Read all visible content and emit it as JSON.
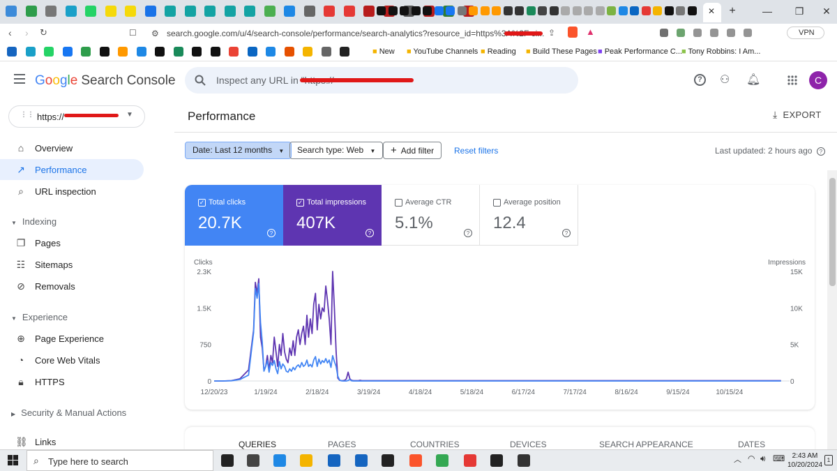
{
  "browser": {
    "url": "search.google.com/u/4/search-console/performance/search-analytics?resource_id=https%3A%2F",
    "url_tail": "ci...",
    "vpn_label": "VPN",
    "bookmarks": [
      "New",
      "YouTube Channels",
      "Reading",
      "Build These Pages",
      "Peak Performance C...",
      "Tony Robbins: I Am..."
    ]
  },
  "app": {
    "logo_google": [
      "G",
      "o",
      "o",
      "g",
      "l",
      "e"
    ],
    "logo_product": "Search Console",
    "search_placeholder": "Inspect any URL in \"https://",
    "avatar_letter": "C"
  },
  "sidebar": {
    "property": "https://",
    "items": {
      "overview": "Overview",
      "performance": "Performance",
      "url_inspection": "URL inspection",
      "indexing_header": "Indexing",
      "pages": "Pages",
      "sitemaps": "Sitemaps",
      "removals": "Removals",
      "experience_header": "Experience",
      "page_experience": "Page Experience",
      "core_web_vitals": "Core Web Vitals",
      "https": "HTTPS",
      "security_header": "Security & Manual Actions",
      "links": "Links"
    }
  },
  "main": {
    "title": "Performance",
    "export": "EXPORT",
    "filters": {
      "date": "Date: Last 12 months",
      "search_type": "Search type: Web",
      "add_filter": "Add filter",
      "reset": "Reset filters"
    },
    "last_updated": "Last updated: 2 hours ago",
    "metrics": {
      "clicks_label": "Total clicks",
      "clicks_value": "20.7K",
      "impressions_label": "Total impressions",
      "impressions_value": "407K",
      "ctr_label": "Average CTR",
      "ctr_value": "5.1%",
      "position_label": "Average position",
      "position_value": "12.4"
    },
    "tabs": [
      "QUERIES",
      "PAGES",
      "COUNTRIES",
      "DEVICES",
      "SEARCH APPEARANCE",
      "DATES"
    ]
  },
  "chart_data": {
    "type": "line",
    "ylabel_left": "Clicks",
    "ylabel_right": "Impressions",
    "left_ticks": [
      "0",
      "750",
      "1.5K",
      "2.3K"
    ],
    "right_ticks": [
      "0",
      "5K",
      "10K",
      "15K"
    ],
    "ylim_left": [
      0,
      2250
    ],
    "ylim_right": [
      0,
      15000
    ],
    "x_ticks": [
      "12/20/23",
      "1/19/24",
      "2/18/24",
      "3/19/24",
      "4/18/24",
      "5/18/24",
      "6/17/24",
      "7/17/24",
      "8/16/24",
      "9/15/24",
      "10/15/24"
    ],
    "series": [
      {
        "name": "Clicks",
        "color": "#4285f4",
        "x": [
          0,
          5,
          10,
          15,
          20,
          23,
          24,
          25,
          26,
          27,
          28,
          29,
          30,
          31,
          32,
          33,
          34,
          35,
          36,
          37,
          38,
          39,
          40,
          41,
          42,
          43,
          44,
          45,
          46,
          47,
          48,
          49,
          50,
          51,
          52,
          53,
          54,
          55,
          56,
          57,
          58,
          59,
          60,
          61,
          62,
          63,
          64,
          65,
          66,
          67,
          68,
          69,
          70,
          71,
          72,
          73,
          74,
          75,
          76,
          77,
          78,
          79,
          80,
          81,
          82,
          83,
          84,
          85,
          86,
          87,
          88,
          89,
          90,
          100,
          110,
          120,
          150,
          180,
          210,
          240,
          270,
          300,
          330
        ],
        "values": [
          0,
          0,
          5,
          30,
          120,
          1000,
          1900,
          1700,
          2000,
          1200,
          800,
          200,
          300,
          420,
          180,
          380,
          320,
          420,
          250,
          150,
          400,
          250,
          350,
          300,
          200,
          180,
          250,
          200,
          280,
          230,
          300,
          330,
          280,
          380,
          300,
          330,
          430,
          300,
          340,
          290,
          430,
          500,
          300,
          450,
          350,
          420,
          380,
          460,
          370,
          430,
          280,
          520,
          400,
          300,
          100,
          20,
          5,
          0,
          0,
          0,
          10,
          30,
          5,
          0,
          0,
          0,
          0,
          0,
          0,
          0,
          0,
          0,
          0,
          0,
          0,
          0,
          0,
          0,
          0,
          0,
          0,
          0,
          0
        ]
      },
      {
        "name": "Impressions",
        "color": "#5e35b1",
        "x": [
          0,
          5,
          10,
          15,
          20,
          23,
          24,
          25,
          26,
          27,
          28,
          29,
          30,
          31,
          32,
          33,
          34,
          35,
          36,
          37,
          38,
          39,
          40,
          41,
          42,
          43,
          44,
          45,
          46,
          47,
          48,
          49,
          50,
          51,
          52,
          53,
          54,
          55,
          56,
          57,
          58,
          59,
          60,
          61,
          62,
          63,
          64,
          65,
          66,
          67,
          68,
          69,
          70,
          71,
          72,
          73,
          74,
          75,
          76,
          77,
          78,
          79,
          80,
          81,
          82,
          83,
          84,
          85,
          86,
          87,
          88,
          89,
          90,
          100,
          110,
          120,
          150,
          180,
          210,
          240,
          270,
          300,
          330
        ],
        "values": [
          0,
          0,
          50,
          300,
          1500,
          7000,
          13500,
          12000,
          14000,
          6000,
          4500,
          1500,
          2000,
          3500,
          1500,
          3500,
          2500,
          6000,
          4000,
          2000,
          5000,
          3500,
          6500,
          4000,
          3000,
          2500,
          4500,
          3500,
          5500,
          3500,
          6000,
          7000,
          5000,
          6500,
          7500,
          5000,
          9000,
          6000,
          8500,
          6500,
          10500,
          12000,
          7000,
          10500,
          8500,
          10000,
          9500,
          13000,
          11000,
          8500,
          5000,
          15000,
          10000,
          4000,
          400,
          100,
          50,
          50,
          100,
          300,
          1200,
          300,
          100,
          50,
          50,
          50,
          50,
          100,
          50,
          50,
          50,
          50,
          50,
          50,
          50,
          50,
          50,
          50,
          50,
          50,
          50,
          50,
          50
        ]
      }
    ]
  }
}
